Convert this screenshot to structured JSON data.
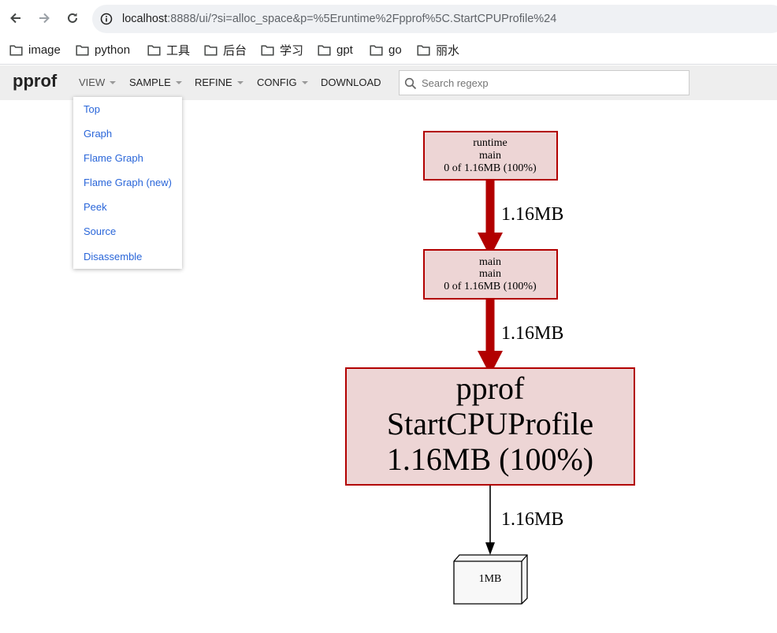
{
  "browser": {
    "url_host": "localhost",
    "url_path": ":8888/ui/?si=alloc_space&p=%5Eruntime%2Fpprof%5C.StartCPUProfile%24",
    "bookmarks": [
      {
        "label": "image",
        "icon": "folder-icon"
      },
      {
        "label": "python",
        "icon": "folder-icon"
      },
      {
        "label": "工具",
        "icon": "folder-icon"
      },
      {
        "label": "后台",
        "icon": "folder-icon"
      },
      {
        "label": "学习",
        "icon": "folder-icon"
      },
      {
        "label": "gpt",
        "icon": "folder-icon"
      },
      {
        "label": "go",
        "icon": "folder-icon"
      },
      {
        "label": "丽水",
        "icon": "folder-icon"
      }
    ]
  },
  "header": {
    "title": "pprof",
    "menus": [
      {
        "label": "VIEW",
        "has_caret": true,
        "open": true
      },
      {
        "label": "SAMPLE",
        "has_caret": true
      },
      {
        "label": "REFINE",
        "has_caret": true
      },
      {
        "label": "CONFIG",
        "has_caret": true
      },
      {
        "label": "DOWNLOAD",
        "has_caret": false
      }
    ],
    "search": {
      "placeholder": "Search regexp",
      "value": ""
    }
  },
  "view_menu": {
    "items": [
      "Top",
      "Graph",
      "Flame Graph",
      "Flame Graph (new)",
      "Peek",
      "Source",
      "Disassemble"
    ]
  },
  "graph": {
    "colors": {
      "node_fill": "#edd5d5",
      "node_border": "#b20000",
      "edge_hot": "#b20000",
      "edge_normal": "#000000",
      "leaf_fill": "#f8f8f8"
    },
    "nodes": [
      {
        "id": "runtime_main",
        "lines": [
          "runtime",
          "main",
          "0 of 1.16MB (100%)"
        ]
      },
      {
        "id": "main_main",
        "lines": [
          "main",
          "main",
          "0 of 1.16MB (100%)"
        ]
      },
      {
        "id": "start_cpu_profile",
        "lines": [
          "pprof",
          "StartCPUProfile",
          "1.16MB (100%)"
        ]
      },
      {
        "id": "leaf_1mb",
        "lines": [
          "1MB"
        ]
      }
    ],
    "edges": [
      {
        "from": "runtime_main",
        "to": "main_main",
        "label": "1.16MB"
      },
      {
        "from": "main_main",
        "to": "start_cpu_profile",
        "label": "1.16MB"
      },
      {
        "from": "start_cpu_profile",
        "to": "leaf_1mb",
        "label": "1.16MB"
      }
    ]
  }
}
